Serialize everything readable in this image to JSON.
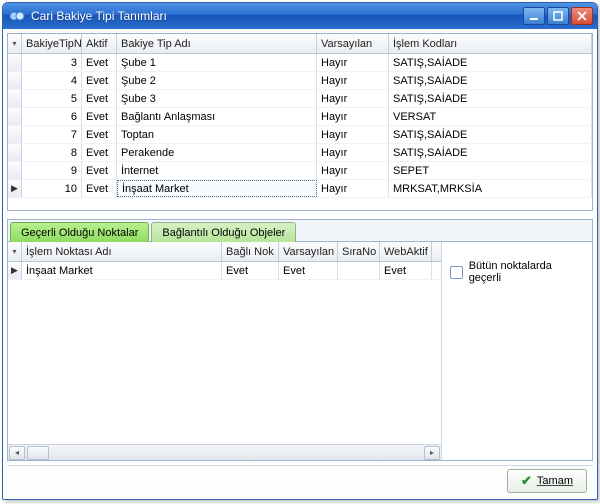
{
  "window": {
    "title": "Cari Bakiye Tipi Tanımları"
  },
  "topGrid": {
    "headers": {
      "no": "BakiyeTipNo",
      "aktif": "Aktif",
      "ad": "Bakiye Tip Adı",
      "vars": "Varsayılan",
      "kod": "İşlem Kodları"
    },
    "rows": [
      {
        "no": "3",
        "aktif": "Evet",
        "ad": "Şube 1",
        "vars": "Hayır",
        "kod": "SATIŞ,SAİADE"
      },
      {
        "no": "4",
        "aktif": "Evet",
        "ad": "Şube 2",
        "vars": "Hayır",
        "kod": "SATIŞ,SAİADE"
      },
      {
        "no": "5",
        "aktif": "Evet",
        "ad": "Şube 3",
        "vars": "Hayır",
        "kod": "SATIŞ,SAİADE"
      },
      {
        "no": "6",
        "aktif": "Evet",
        "ad": "Bağlantı Anlaşması",
        "vars": "Hayır",
        "kod": "VERSAT"
      },
      {
        "no": "7",
        "aktif": "Evet",
        "ad": "Toptan",
        "vars": "Hayır",
        "kod": "SATIŞ,SAİADE"
      },
      {
        "no": "8",
        "aktif": "Evet",
        "ad": "Perakende",
        "vars": "Hayır",
        "kod": "SATIŞ,SAİADE"
      },
      {
        "no": "9",
        "aktif": "Evet",
        "ad": "İnternet",
        "vars": "Hayır",
        "kod": "SEPET"
      },
      {
        "no": "10",
        "aktif": "Evet",
        "ad": "İnşaat Market",
        "vars": "Hayır",
        "kod": "MRKSAT,MRKSİA"
      }
    ],
    "selectedIndex": 7
  },
  "tabs": {
    "tab1": "Geçerli Olduğu Noktalar",
    "tab2": "Bağlantılı Olduğu Objeler"
  },
  "detailGrid": {
    "headers": {
      "ad": "İşlem Noktası Adı",
      "bagli": "Bağlı Nok",
      "vars": "Varsayılan",
      "sira": "SıraNo",
      "web": "WebAktif"
    },
    "rows": [
      {
        "ad": "İnşaat Market",
        "bagli": "Evet",
        "vars": "Evet",
        "sira": "",
        "web": "Evet"
      }
    ]
  },
  "sidePanel": {
    "allPointsLabel": "Bütün noktalarda geçerli"
  },
  "footer": {
    "okLabel": "Tamam"
  }
}
